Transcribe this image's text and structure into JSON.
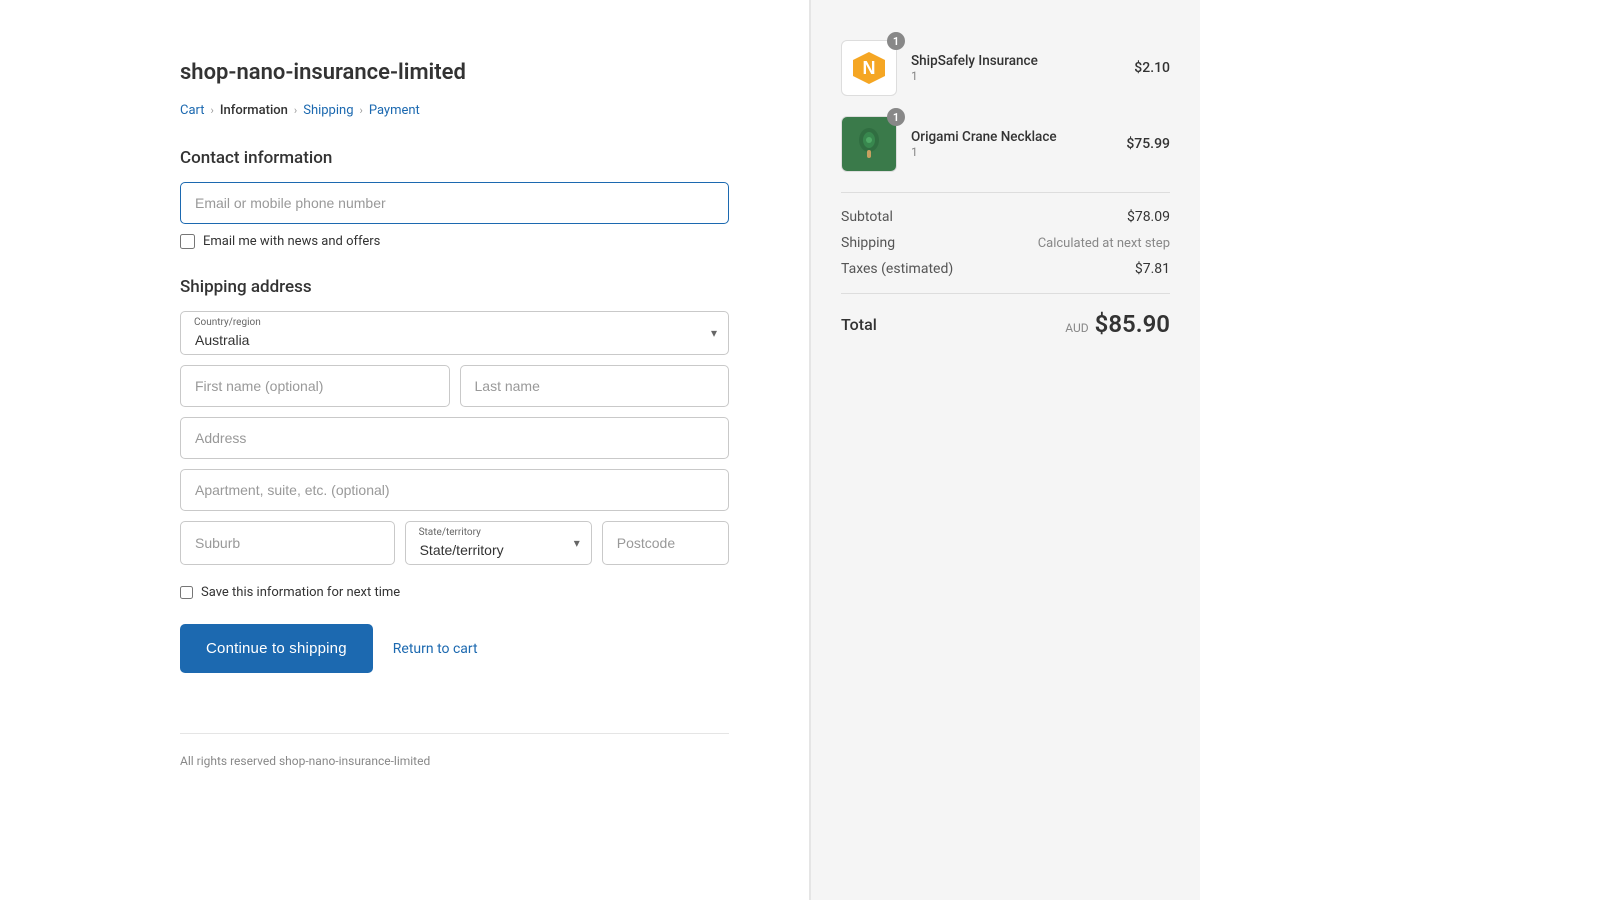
{
  "store": {
    "title": "shop-nano-insurance-limited",
    "footer": "All rights reserved shop-nano-insurance-limited"
  },
  "breadcrumb": {
    "items": [
      {
        "label": "Cart",
        "active": false
      },
      {
        "label": "Information",
        "active": true
      },
      {
        "label": "Shipping",
        "active": false
      },
      {
        "label": "Payment",
        "active": false
      }
    ]
  },
  "contact": {
    "section_title": "Contact information",
    "email_placeholder": "Email or mobile phone number",
    "newsletter_label": "Email me with news and offers"
  },
  "shipping": {
    "section_title": "Shipping address",
    "country_label": "Country/region",
    "country_value": "Australia",
    "first_name_placeholder": "First name (optional)",
    "last_name_placeholder": "Last name",
    "address_placeholder": "Address",
    "apartment_placeholder": "Apartment, suite, etc. (optional)",
    "suburb_placeholder": "Suburb",
    "state_label": "State/territory",
    "state_value": "State/territory",
    "postcode_placeholder": "Postcode",
    "save_label": "Save this information for next time"
  },
  "actions": {
    "continue_label": "Continue to shipping",
    "return_label": "Return to cart"
  },
  "order": {
    "items": [
      {
        "name": "ShipSafely Insurance",
        "qty": "1",
        "price": "$2.10",
        "badge": "1",
        "type": "shipsafely"
      },
      {
        "name": "Origami Crane Necklace",
        "qty": "1",
        "price": "$75.99",
        "badge": "1",
        "type": "necklace"
      }
    ],
    "subtotal_label": "Subtotal",
    "subtotal_value": "$78.09",
    "shipping_label": "Shipping",
    "shipping_value": "Calculated at next step",
    "taxes_label": "Taxes (estimated)",
    "taxes_value": "$7.81",
    "total_label": "Total",
    "total_currency": "AUD",
    "total_value": "$85.90"
  }
}
